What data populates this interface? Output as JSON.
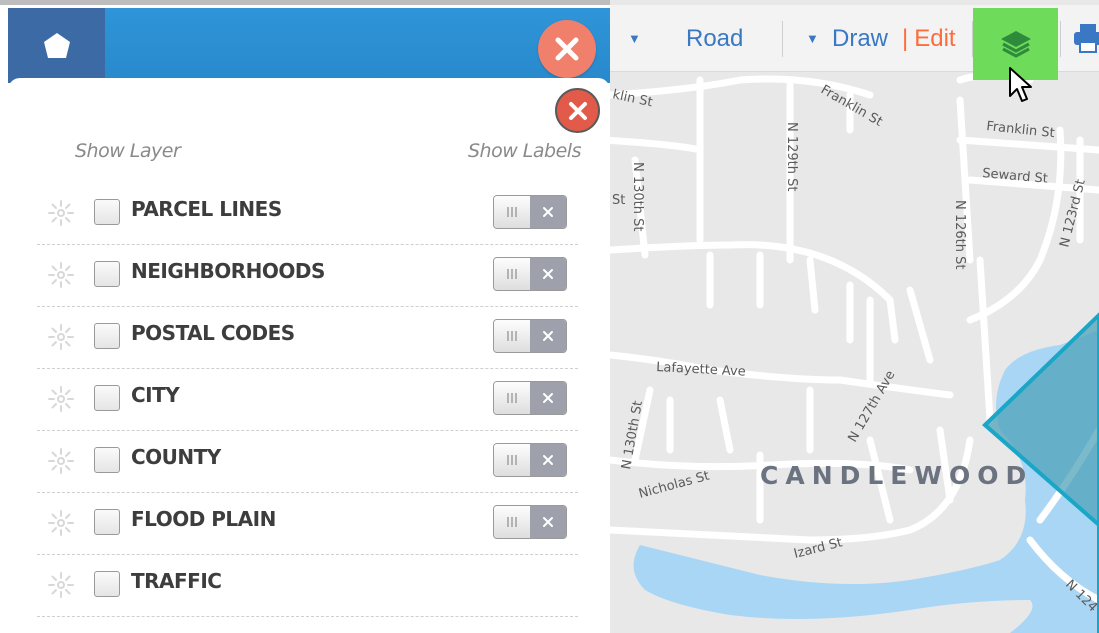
{
  "toolbar": {
    "road_label": "Road",
    "draw_label": "Draw",
    "edit_label": "Edit",
    "layers_icon": "layers-icon",
    "print_icon": "print-icon",
    "active_color": "#6fdb5a"
  },
  "panel": {
    "show_layer_label": "Show Layer",
    "show_labels_label": "Show Labels",
    "header_color": "#2f95d8",
    "layers": [
      {
        "name": "PARCEL LINES",
        "checked": false,
        "labels_toggle": true
      },
      {
        "name": "NEIGHBORHOODS",
        "checked": false,
        "labels_toggle": true
      },
      {
        "name": "POSTAL CODES",
        "checked": false,
        "labels_toggle": true
      },
      {
        "name": "CITY",
        "checked": false,
        "labels_toggle": true
      },
      {
        "name": "COUNTY",
        "checked": false,
        "labels_toggle": true
      },
      {
        "name": "FLOOD PLAIN",
        "checked": false,
        "labels_toggle": true
      },
      {
        "name": "TRAFFIC",
        "checked": false,
        "labels_toggle": false
      }
    ]
  },
  "map": {
    "area_label": "CANDLEWOOD",
    "streets": {
      "franklin_top_left": "klin St",
      "franklin_mid": "Franklin St",
      "franklin_right": "Franklin St",
      "seward": "Seward St",
      "n129": "N 129th St",
      "n130_top": "N 130th St",
      "st_left": "St",
      "n126": "N 126th St",
      "n123": "N 123rd St",
      "lafayette": "Lafayette Ave",
      "n130_bottom": "N 130th St",
      "n127": "N 127th Ave",
      "nicholas": "Nicholas St",
      "izard": "Izard St",
      "n124": "N 124"
    }
  }
}
